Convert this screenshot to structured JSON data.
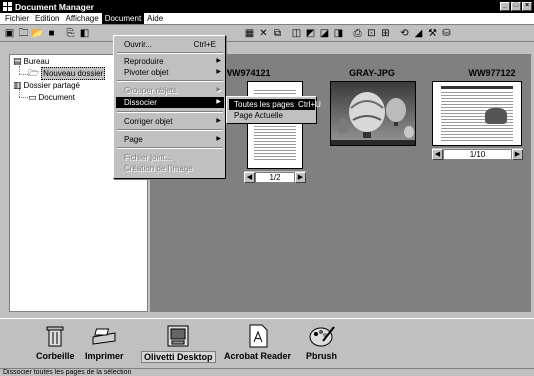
{
  "window": {
    "title": "Document Manager"
  },
  "menubar": [
    "Fichier",
    "Edition",
    "Affichage",
    "Document",
    "Aide"
  ],
  "tree": {
    "items": [
      {
        "label": "Bureau",
        "icon": "desktop-icon"
      },
      {
        "label": "Nouveau dossier",
        "icon": "folder-open-icon"
      },
      {
        "label": "Dossier partagé",
        "icon": "shared-folder-icon"
      },
      {
        "label": "Document",
        "icon": "document-icon"
      }
    ]
  },
  "document_menu": {
    "ouvrir": "Ouvrir...",
    "ouvrir_shortcut": "Ctrl+E",
    "reproduire": "Reproduire",
    "pivoter": "Pivoter objet",
    "grouper": "Grouper objets",
    "dissocier": "Dissocier",
    "corriger": "Corriger objet",
    "page": "Page",
    "fichier_joint": "Fichier joint...",
    "creation_image": "Création de l'image"
  },
  "dissocier_submenu": {
    "toutes": "Toutes les pages",
    "toutes_shortcut": "Ctrl+U",
    "actuelle": "Page Actuelle"
  },
  "thumbnails": [
    {
      "title": "WW974121",
      "pager": "1/2"
    },
    {
      "title": "GRAY-JPG"
    },
    {
      "title": "WW977122",
      "pager": "1/10"
    }
  ],
  "taskbar": [
    {
      "label": "Corbeille",
      "icon": "recycle-bin-icon"
    },
    {
      "label": "Imprimer",
      "icon": "printer-icon"
    },
    {
      "label": "Olivetti Desktop",
      "icon": "olivetti-desktop-icon"
    },
    {
      "label": "Acrobat Reader",
      "icon": "acrobat-icon"
    },
    {
      "label": "Pbrush",
      "icon": "paintbrush-icon"
    }
  ],
  "status": "Dissocier toutes les pages de la sélection"
}
